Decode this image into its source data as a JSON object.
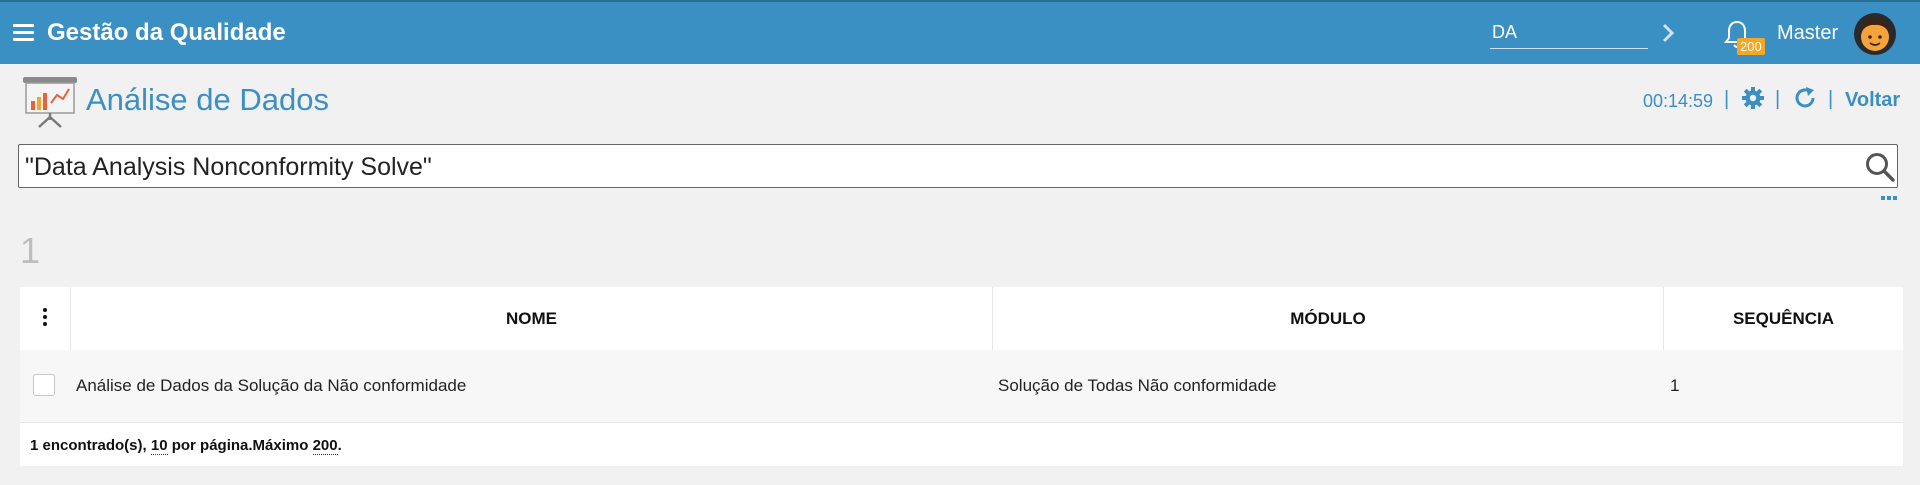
{
  "topbar": {
    "app_title": "Gestão da Qualidade",
    "quick_value": "DA",
    "notification_count": "200",
    "user_name": "Master",
    "accent": "#3a8fc3"
  },
  "header": {
    "title": "Análise de Dados",
    "timer": "00:14:59",
    "separator": "|",
    "back_label": "Voltar"
  },
  "search": {
    "value": "\"Data Analysis Nonconformity Solve\""
  },
  "results": {
    "count": "1"
  },
  "table": {
    "columns": [
      "NOME",
      "MÓDULO",
      "SEQUÊNCIA"
    ],
    "rows": [
      {
        "nome": "Análise de Dados da Solução da Não conformidade",
        "modulo": "Solução de Todas Não conformidade",
        "sequencia": "1"
      }
    ],
    "footer": {
      "found": "1 encontrado(s), ",
      "per_page_value": "10",
      "per_page_label": " por página.Máximo ",
      "max_value": "200",
      "end": "."
    }
  }
}
